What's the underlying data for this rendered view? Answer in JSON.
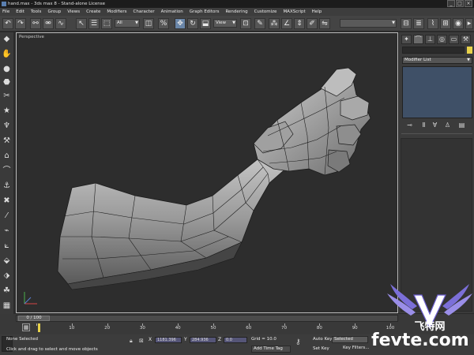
{
  "window": {
    "title": "hand.max - 3ds max 8 - Stand-alone License",
    "controls": [
      "_",
      "□",
      "×"
    ]
  },
  "menu": [
    "File",
    "Edit",
    "Tools",
    "Group",
    "Views",
    "Create",
    "Modifiers",
    "Character",
    "Animation",
    "Graph Editors",
    "Rendering",
    "Customize",
    "MAXScript",
    "Help"
  ],
  "toolbar": {
    "selection_filter": "All",
    "reference_coord": "View"
  },
  "viewport": {
    "label": "Perspective"
  },
  "command_panel": {
    "modifier_list": "Modifier List",
    "name_swatch_color": "#e8d24a",
    "stack_color": "#3f5067"
  },
  "timeline": {
    "slider_label": "0 / 100",
    "current_frame": 0,
    "total_frames": 100,
    "ticks": [
      "0",
      "10",
      "20",
      "30",
      "40",
      "50",
      "60",
      "70",
      "80",
      "90",
      "100"
    ]
  },
  "status": {
    "selection": "None Selected",
    "prompt": "Click and drag to select and move objects",
    "x_label": "X",
    "x_value": "1181.396",
    "y_label": "Y",
    "y_value": "284.936",
    "z_label": "Z",
    "z_value": "0.0",
    "grid": "Grid = 10.0",
    "add_time_tag": "Add Time Tag",
    "auto_key": "Auto Key",
    "set_key": "Set Key",
    "selected": "Selected",
    "key_filters": "Key Filters..."
  },
  "watermark": {
    "text": "fevte.com",
    "logo_text": "飞特网"
  }
}
